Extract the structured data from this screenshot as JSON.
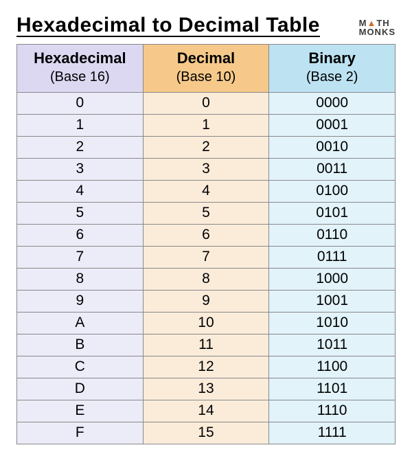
{
  "title": "Hexadecimal to Decimal Table",
  "logo": {
    "line1_pre": "M",
    "line1_tri": "▲",
    "line1_post": "TH",
    "line2": "MONKS"
  },
  "columns": {
    "hex": {
      "title": "Hexadecimal",
      "sub": "(Base 16)"
    },
    "dec": {
      "title": "Decimal",
      "sub": "(Base 10)"
    },
    "bin": {
      "title": "Binary",
      "sub": "(Base 2)"
    }
  },
  "rows": [
    {
      "hex": "0",
      "dec": "0",
      "bin": "0000"
    },
    {
      "hex": "1",
      "dec": "1",
      "bin": "0001"
    },
    {
      "hex": "2",
      "dec": "2",
      "bin": "0010"
    },
    {
      "hex": "3",
      "dec": "3",
      "bin": "0011"
    },
    {
      "hex": "4",
      "dec": "4",
      "bin": "0100"
    },
    {
      "hex": "5",
      "dec": "5",
      "bin": "0101"
    },
    {
      "hex": "6",
      "dec": "6",
      "bin": "0110"
    },
    {
      "hex": "7",
      "dec": "7",
      "bin": "0111"
    },
    {
      "hex": "8",
      "dec": "8",
      "bin": "1000"
    },
    {
      "hex": "9",
      "dec": "9",
      "bin": "1001"
    },
    {
      "hex": "A",
      "dec": "10",
      "bin": "1010"
    },
    {
      "hex": "B",
      "dec": "11",
      "bin": "1011"
    },
    {
      "hex": "C",
      "dec": "12",
      "bin": "1100"
    },
    {
      "hex": "D",
      "dec": "13",
      "bin": "1101"
    },
    {
      "hex": "E",
      "dec": "14",
      "bin": "1110"
    },
    {
      "hex": "F",
      "dec": "15",
      "bin": "1111"
    }
  ]
}
